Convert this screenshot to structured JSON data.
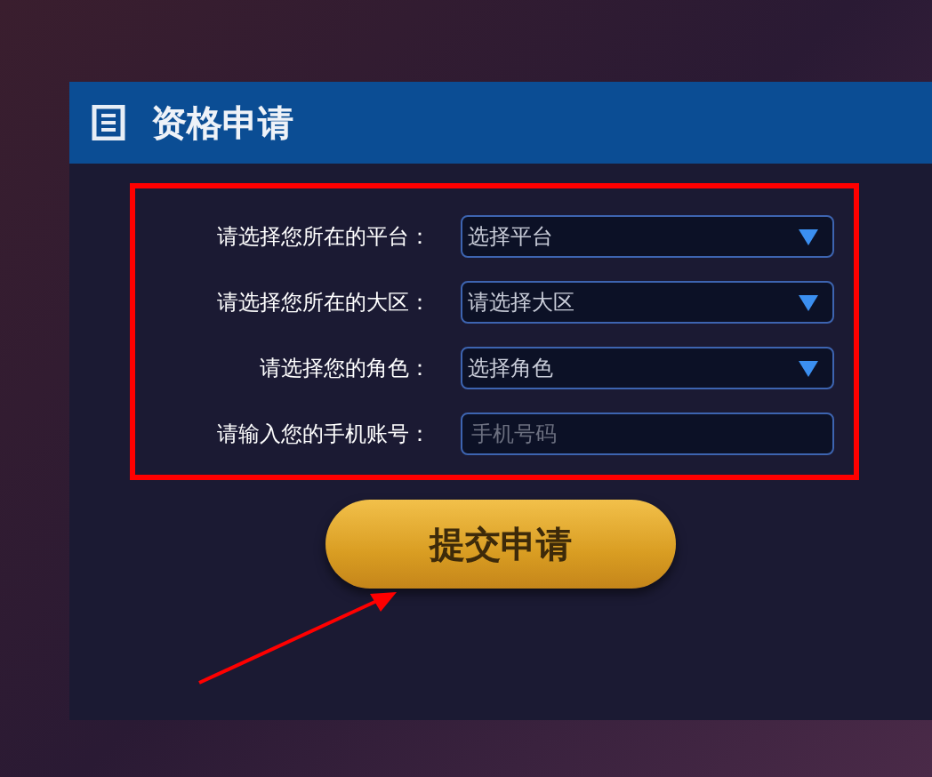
{
  "panel": {
    "title": "资格申请"
  },
  "fields": [
    {
      "kind": "select",
      "label": "请选择您所在的平台：",
      "value": "选择平台"
    },
    {
      "kind": "select",
      "label": "请选择您所在的大区：",
      "value": "请选择大区"
    },
    {
      "kind": "select",
      "label": "请选择您的角色：",
      "value": "选择角色"
    },
    {
      "kind": "input",
      "label": "请输入您的手机账号：",
      "placeholder": "手机号码"
    }
  ],
  "submit_button": "提交申请"
}
